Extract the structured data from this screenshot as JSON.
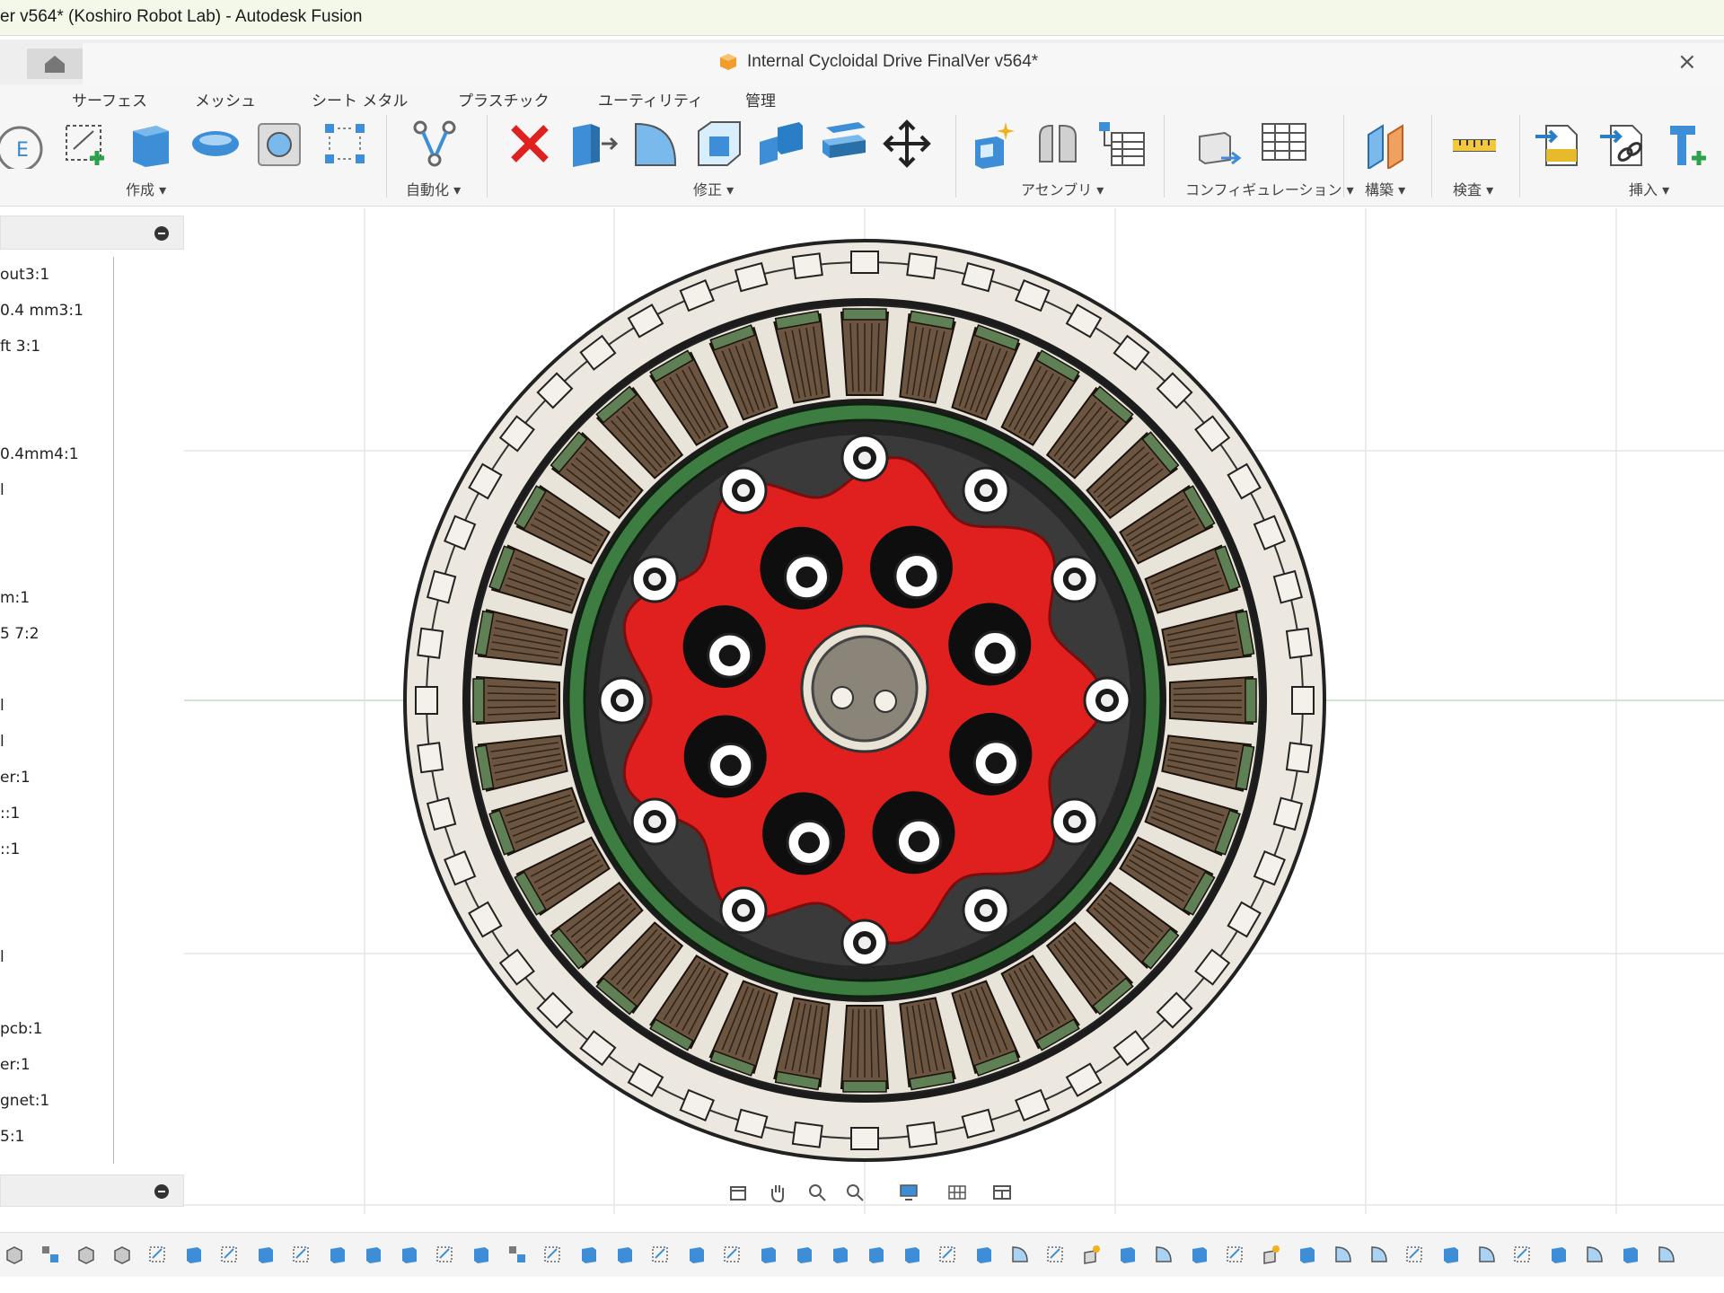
{
  "window": {
    "title": "er v564* (Koshiro Robot Lab) - Autodesk Fusion"
  },
  "document_tab": {
    "title": "Internal Cycloidal Drive FinalVer v564*",
    "close_glyph": "×"
  },
  "ribbon": {
    "tabs": [
      "サーフェス",
      "メッシュ",
      "シート メタル",
      "プラスチック",
      "ユーティリティ",
      "管理"
    ],
    "groups": [
      "作成 ▾",
      "自動化 ▾",
      "修正 ▾",
      "アセンブリ ▾",
      "コンフィギュレーション ▾",
      "構築 ▾",
      "検査 ▾",
      "挿入 ▾"
    ]
  },
  "browser": {
    "items": [
      "out3:1",
      "0.4 mm3:1",
      "ft 3:1",
      "0.4mm4:1",
      "l",
      "m:1",
      "5 7:2",
      "l",
      "l",
      "er:1",
      "::1",
      "::1",
      "l",
      "pcb:1",
      "er:1",
      "gnet:1",
      "5:1"
    ]
  },
  "colors": {
    "cycloid_disc": "#e01f1f",
    "ring_green": "#3e7d42",
    "coil_brown": "#6b5440",
    "outer_ring": "#ece8df",
    "dark": "#1c1c1c"
  }
}
